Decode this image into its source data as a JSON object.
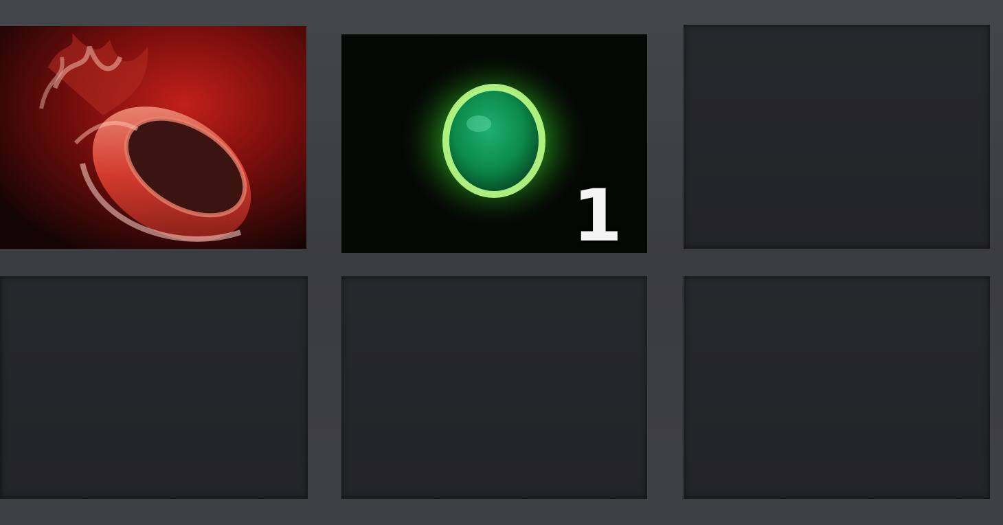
{
  "inventory": {
    "slots": [
      {
        "row": 1,
        "col": 1,
        "item_icon": "crimson-ring-icon",
        "count": ""
      },
      {
        "row": 1,
        "col": 2,
        "item_icon": "green-orb-icon",
        "count": "1"
      },
      {
        "row": 1,
        "col": 3,
        "item_icon": "",
        "count": ""
      },
      {
        "row": 2,
        "col": 1,
        "item_icon": "",
        "count": ""
      },
      {
        "row": 2,
        "col": 2,
        "item_icon": "",
        "count": ""
      },
      {
        "row": 2,
        "col": 3,
        "item_icon": "",
        "count": ""
      }
    ],
    "colors": {
      "frame": "#3e3f43",
      "slot_background": "#252629",
      "ring_red": "#c0211c",
      "orb_green": "#3fe040",
      "count_text": "#f4f4f4"
    }
  }
}
